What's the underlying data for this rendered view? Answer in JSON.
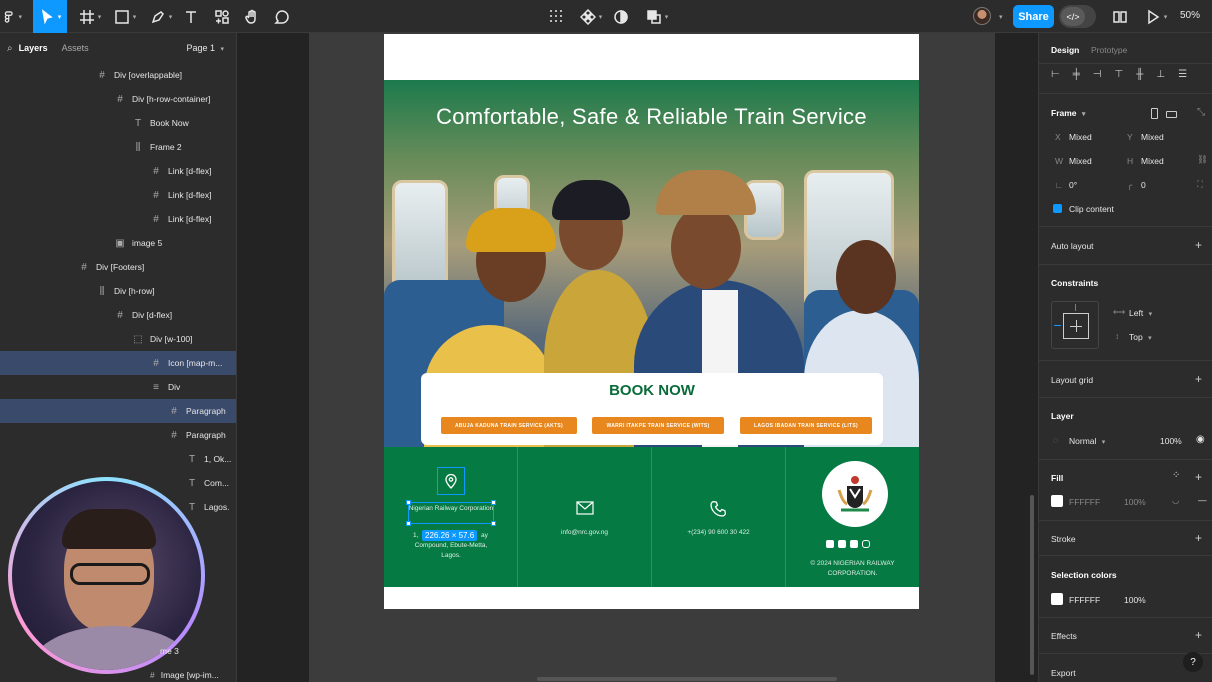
{
  "toolbar": {
    "share_label": "Share",
    "zoom_label": "50%",
    "dev_mode_label": "</>"
  },
  "left_panel": {
    "tabs": [
      "Layers",
      "Assets"
    ],
    "page_selector": "Page 1",
    "layers": [
      {
        "label": "Div [overlappable]",
        "icon": "frame-icon",
        "indent": 0
      },
      {
        "label": "Div [h-row-container]",
        "icon": "frame-icon",
        "indent": 1
      },
      {
        "label": "Book Now",
        "icon": "text-icon",
        "indent": 2
      },
      {
        "label": "Frame 2",
        "icon": "auto-layout-icon",
        "indent": 2
      },
      {
        "label": "Link [d-flex]",
        "icon": "frame-icon",
        "indent": 3
      },
      {
        "label": "Link [d-flex]",
        "icon": "frame-icon",
        "indent": 3
      },
      {
        "label": "Link [d-flex]",
        "icon": "frame-icon",
        "indent": 3
      },
      {
        "label": "image 5",
        "icon": "image-icon",
        "indent": 1
      },
      {
        "label": "Div [Footers]",
        "icon": "frame-icon",
        "indent": -1
      },
      {
        "label": "Div [h-row]",
        "icon": "auto-layout-icon",
        "indent": 0
      },
      {
        "label": "Div [d-flex]",
        "icon": "frame-icon",
        "indent": 1
      },
      {
        "label": "Div [w-100]",
        "icon": "dashed-frame-icon",
        "indent": 2
      },
      {
        "label": "Icon [map-m...",
        "icon": "frame-icon",
        "indent": 3,
        "selected": true
      },
      {
        "label": "Div",
        "icon": "rows-icon",
        "indent": 3
      },
      {
        "label": "Paragraph",
        "icon": "frame-icon",
        "indent": 4,
        "selected": true
      },
      {
        "label": "Paragraph",
        "icon": "frame-icon",
        "indent": 4
      },
      {
        "label": "1, Ok...",
        "icon": "text-icon",
        "indent": 5
      },
      {
        "label": "Com...",
        "icon": "text-icon",
        "indent": 5
      },
      {
        "label": "Lagos.",
        "icon": "text-icon",
        "indent": 5
      }
    ],
    "bottom_layers": [
      {
        "label": "me 3"
      },
      {
        "label": "Image [wp-im..."
      }
    ]
  },
  "webpage": {
    "hero_title": "Comfortable, Safe & Reliable Train Service",
    "book_title": "BOOK NOW",
    "routes": [
      "ABUJA KADUNA TRAIN SERVICE (AKTS)",
      "WARRI ITAKPE TRAIN SERVICE (WITS)",
      "LAGOS IBADAN TRAIN SERVICE (LITS)"
    ],
    "footer": {
      "address_title": "Nigerian Railway Corporation",
      "address_lines": [
        "1,",
        "ay",
        "Compound, Ebute-Metta,",
        "Lagos."
      ],
      "selection_dims": "226.26 × 57.6",
      "email": "info@nrc.gov.ng",
      "phone": "+(234) 90 600 30 422",
      "copyright": "© 2024 NIGERIAN RAILWAY CORPORATION."
    }
  },
  "right_panel": {
    "tabs": [
      "Design",
      "Prototype"
    ],
    "frame": {
      "title": "Frame",
      "x_label": "X",
      "x_value": "Mixed",
      "y_label": "Y",
      "y_value": "Mixed",
      "w_label": "W",
      "w_value": "Mixed",
      "h_label": "H",
      "h_value": "Mixed",
      "rotation": "0°",
      "radius": "0",
      "clip_content": "Clip content"
    },
    "auto_layout": "Auto layout",
    "constraints": {
      "title": "Constraints",
      "horizontal": "Left",
      "vertical": "Top"
    },
    "layout_grid": "Layout grid",
    "layer": {
      "title": "Layer",
      "blend": "Normal",
      "opacity": "100%"
    },
    "fill": {
      "title": "Fill",
      "hex": "FFFFFF",
      "opacity": "100%"
    },
    "stroke": "Stroke",
    "selection_colors": {
      "title": "Selection colors",
      "hex": "FFFFFF",
      "opacity": "100%"
    },
    "effects": "Effects",
    "export": "Export"
  },
  "help_label": "?",
  "colors": {
    "accent": "#0d99ff",
    "brand_green": "#067a43",
    "route_orange": "#e8871d"
  }
}
